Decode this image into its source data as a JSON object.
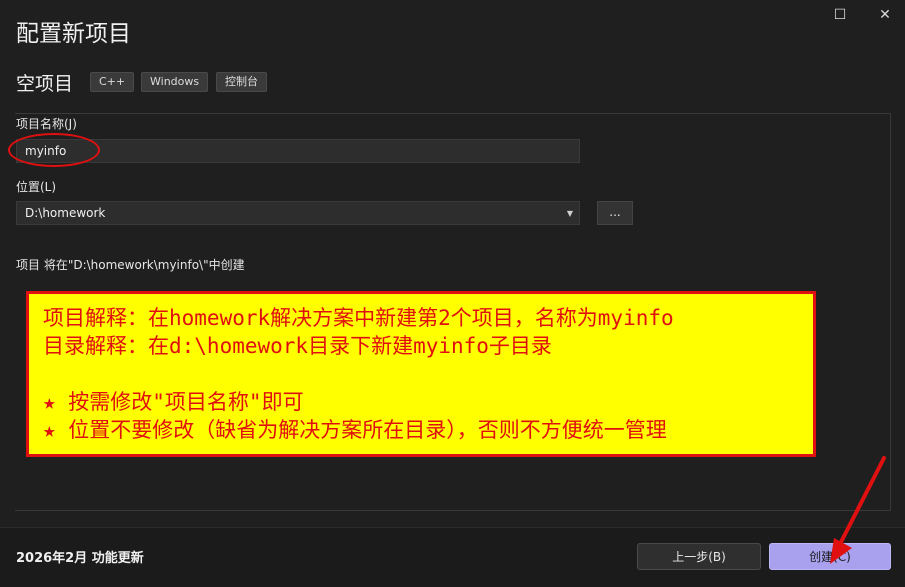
{
  "window": {
    "title": "配置新项目",
    "maximize_icon": "maximize-icon",
    "close_icon": "close-icon"
  },
  "template": {
    "name": "空项目",
    "tags": [
      "C++",
      "Windows",
      "控制台"
    ]
  },
  "form": {
    "project_name_label": "项目名称(J)",
    "project_name_value": "myinfo",
    "location_label": "位置(L)",
    "location_value": "D:\\homework",
    "browse_label": "...",
    "creation_path_text": "项目 将在\"D:\\homework\\myinfo\\\"中创建"
  },
  "annotation": {
    "lines": [
      "项目解释：在homework解决方案中新建第2个项目，名称为myinfo",
      "目录解释：在d:\\homework目录下新建myinfo子目录",
      "",
      "★ 按需修改\"项目名称\"即可",
      "★ 位置不要修改（缺省为解决方案所在目录），否则不方便统一管理"
    ],
    "colors": {
      "background": "#ffff00",
      "text": "#e01010",
      "border": "#e01010"
    }
  },
  "footer": {
    "update_text": "2026年2月 功能更新",
    "back_label": "上一步(B)",
    "create_label": "创建(C)"
  },
  "colors": {
    "accent": "#a9a0ee",
    "background": "#1f1f1f"
  }
}
